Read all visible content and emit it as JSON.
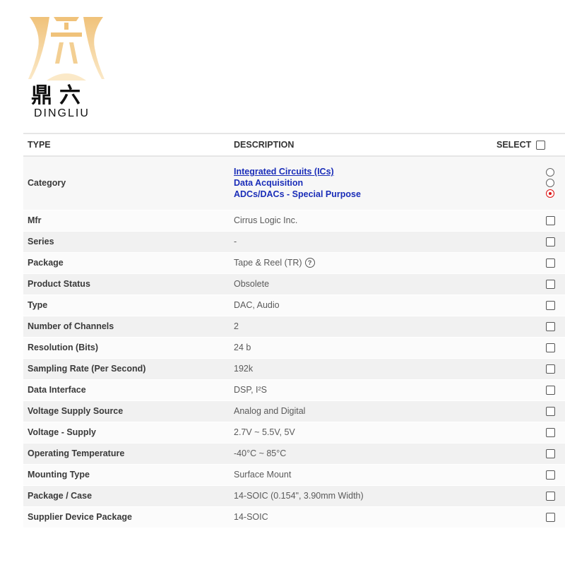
{
  "brand": {
    "name_cn": "鼎六",
    "name_en": "DINGLIU"
  },
  "colors": {
    "logo_gold": "#e8b86a",
    "link_blue": "#1a2db8",
    "radio_selected": "#d11111"
  },
  "table": {
    "headers": {
      "type": "TYPE",
      "description": "DESCRIPTION",
      "select": "SELECT"
    },
    "category": {
      "label": "Category",
      "links": [
        "Integrated Circuits (ICs)",
        "Data Acquisition",
        "ADCs/DACs - Special Purpose"
      ],
      "selected_index": 2
    },
    "rows": [
      {
        "type": "Mfr",
        "value": "Cirrus Logic Inc."
      },
      {
        "type": "Series",
        "value": "-"
      },
      {
        "type": "Package",
        "value": "Tape & Reel (TR)",
        "help_icon": "?"
      },
      {
        "type": "Product Status",
        "value": "Obsolete"
      },
      {
        "type": "Type",
        "value": "DAC, Audio"
      },
      {
        "type": "Number of Channels",
        "value": "2"
      },
      {
        "type": "Resolution (Bits)",
        "value": "24 b"
      },
      {
        "type": "Sampling Rate (Per Second)",
        "value": "192k"
      },
      {
        "type": "Data Interface",
        "value": "DSP, I²S"
      },
      {
        "type": "Voltage Supply Source",
        "value": "Analog and Digital"
      },
      {
        "type": "Voltage - Supply",
        "value": "2.7V ~ 5.5V, 5V"
      },
      {
        "type": "Operating Temperature",
        "value": "-40°C ~ 85°C"
      },
      {
        "type": "Mounting Type",
        "value": "Surface Mount"
      },
      {
        "type": "Package / Case",
        "value": "14-SOIC (0.154\", 3.90mm Width)"
      },
      {
        "type": "Supplier Device Package",
        "value": "14-SOIC"
      }
    ]
  }
}
